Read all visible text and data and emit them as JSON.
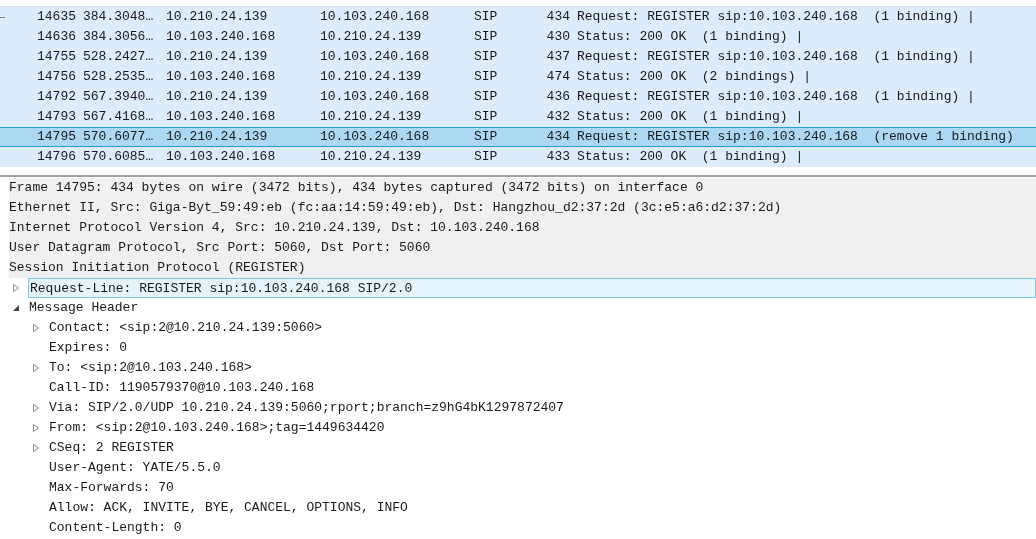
{
  "packet_list": {
    "rows": [
      {
        "no": "14635",
        "time": "384.3048…",
        "source": "10.210.24.139",
        "destination": "10.103.240.168",
        "protocol": "SIP",
        "length": "434",
        "info": "Request: REGISTER sip:10.103.240.168  (1 binding) |",
        "selected": false,
        "related": true
      },
      {
        "no": "14636",
        "time": "384.3056…",
        "source": "10.103.240.168",
        "destination": "10.210.24.139",
        "protocol": "SIP",
        "length": "430",
        "info": "Status: 200 OK  (1 binding) |",
        "selected": false,
        "related": false
      },
      {
        "no": "14755",
        "time": "528.2427…",
        "source": "10.210.24.139",
        "destination": "10.103.240.168",
        "protocol": "SIP",
        "length": "437",
        "info": "Request: REGISTER sip:10.103.240.168  (1 binding) |",
        "selected": false,
        "related": false
      },
      {
        "no": "14756",
        "time": "528.2535…",
        "source": "10.103.240.168",
        "destination": "10.210.24.139",
        "protocol": "SIP",
        "length": "474",
        "info": "Status: 200 OK  (2 bindings) |",
        "selected": false,
        "related": false
      },
      {
        "no": "14792",
        "time": "567.3940…",
        "source": "10.210.24.139",
        "destination": "10.103.240.168",
        "protocol": "SIP",
        "length": "436",
        "info": "Request: REGISTER sip:10.103.240.168  (1 binding) |",
        "selected": false,
        "related": false
      },
      {
        "no": "14793",
        "time": "567.4168…",
        "source": "10.103.240.168",
        "destination": "10.210.24.139",
        "protocol": "SIP",
        "length": "432",
        "info": "Status: 200 OK  (1 binding) |",
        "selected": false,
        "related": false
      },
      {
        "no": "14795",
        "time": "570.6077…",
        "source": "10.210.24.139",
        "destination": "10.103.240.168",
        "protocol": "SIP",
        "length": "434",
        "info": "Request: REGISTER sip:10.103.240.168  (remove 1 binding)",
        "selected": true,
        "related": false
      },
      {
        "no": "14796",
        "time": "570.6085…",
        "source": "10.103.240.168",
        "destination": "10.210.24.139",
        "protocol": "SIP",
        "length": "433",
        "info": "Status: 200 OK  (1 binding) |",
        "selected": false,
        "related": false
      }
    ]
  },
  "packet_details": [
    {
      "kind": "layer",
      "text": "Frame 14795: 434 bytes on wire (3472 bits), 434 bytes captured (3472 bits) on interface 0",
      "selected": false
    },
    {
      "kind": "layer",
      "text": "Ethernet II, Src: Giga-Byt_59:49:eb (fc:aa:14:59:49:eb), Dst: Hangzhou_d2:37:2d (3c:e5:a6:d2:37:2d)",
      "selected": false
    },
    {
      "kind": "layer",
      "text": "Internet Protocol Version 4, Src: 10.210.24.139, Dst: 10.103.240.168",
      "selected": false
    },
    {
      "kind": "layer",
      "text": "User Datagram Protocol, Src Port: 5060, Dst Port: 5060",
      "selected": false
    },
    {
      "kind": "layer",
      "text": "Session Initiation Protocol (REGISTER)",
      "selected": false,
      "children": [
        {
          "kind": "branch",
          "text": "Request-Line: REGISTER sip:10.103.240.168 SIP/2.0",
          "expanded": false,
          "selected": true
        },
        {
          "kind": "branch",
          "text": "Message Header",
          "expanded": true,
          "selected": false,
          "children": [
            {
              "kind": "branch",
              "text": "Contact: <sip:2@10.210.24.139:5060>",
              "expanded": false,
              "selected": false
            },
            {
              "kind": "leaf",
              "text": "Expires: 0",
              "selected": false
            },
            {
              "kind": "branch",
              "text": "To: <sip:2@10.103.240.168>",
              "expanded": false,
              "selected": false
            },
            {
              "kind": "leaf",
              "text": "Call-ID: 1190579370@10.103.240.168",
              "selected": false
            },
            {
              "kind": "branch",
              "text": "Via: SIP/2.0/UDP 10.210.24.139:5060;rport;branch=z9hG4bK1297872407",
              "expanded": false,
              "selected": false
            },
            {
              "kind": "branch",
              "text": "From: <sip:2@10.103.240.168>;tag=1449634420",
              "expanded": false,
              "selected": false
            },
            {
              "kind": "branch",
              "text": "CSeq: 2 REGISTER",
              "expanded": false,
              "selected": false
            },
            {
              "kind": "leaf",
              "text": "User-Agent: YATE/5.5.0",
              "selected": false
            },
            {
              "kind": "leaf",
              "text": "Max-Forwards: 70",
              "selected": false
            },
            {
              "kind": "leaf",
              "text": "Allow: ACK, INVITE, BYE, CANCEL, OPTIONS, INFO",
              "selected": false
            },
            {
              "kind": "leaf",
              "text": "Content-Length: 0",
              "selected": false
            }
          ]
        }
      ]
    }
  ]
}
